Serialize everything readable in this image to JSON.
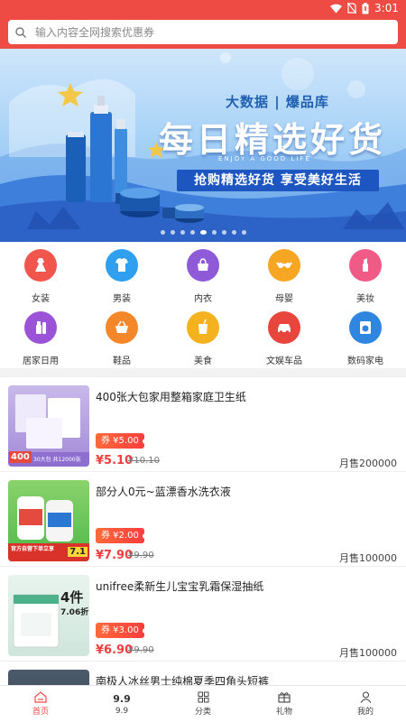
{
  "status": {
    "time": "3:01"
  },
  "search": {
    "placeholder": "输入内容全网搜索优惠券"
  },
  "banner": {
    "subtitle": "大数据 | 爆品库",
    "title": "每日精选好货",
    "english": "ENJOY A GOOD LIFE",
    "slogan": "抢购精选好货  享受美好生活",
    "dot_count": 9,
    "active_dot": 4
  },
  "categories": [
    {
      "label": "女装",
      "icon": "dress-icon",
      "color": "#f0564b"
    },
    {
      "label": "男装",
      "icon": "shirt-icon",
      "color": "#2f9ff0"
    },
    {
      "label": "内衣",
      "icon": "bag-icon",
      "color": "#8e5ad8"
    },
    {
      "label": "母婴",
      "icon": "bra-icon",
      "color": "#f6a623"
    },
    {
      "label": "美妆",
      "icon": "lipstick-icon",
      "color": "#f05a86"
    },
    {
      "label": "居家日用",
      "icon": "cleaning-icon",
      "color": "#9a53d6"
    },
    {
      "label": "鞋品",
      "icon": "basket-icon",
      "color": "#f5872b"
    },
    {
      "label": "美食",
      "icon": "drink-icon",
      "color": "#f4b21e"
    },
    {
      "label": "文娱车品",
      "icon": "car-icon",
      "color": "#e8453c"
    },
    {
      "label": "数码家电",
      "icon": "washer-icon",
      "color": "#2e86e0"
    }
  ],
  "products": [
    {
      "title": "400张大包家用整箱家庭卫生纸",
      "coupon": "券 ¥5.00",
      "price": "¥5.10",
      "original": "¥10.10",
      "sales": "月售200000",
      "thumb_caption": "400",
      "thumb_sub": "30大包 共12000张"
    },
    {
      "title": "部分人0元~蓝漂香水洗衣液",
      "coupon": "券 ¥2.00",
      "price": "¥7.90",
      "original": "¥9.90",
      "sales": "月售100000",
      "thumb_caption": "7.1",
      "thumb_sub": "官方自营下单立享"
    },
    {
      "title": "unifree柔新生儿宝宝乳霜保湿抽纸",
      "coupon": "券 ¥3.00",
      "price": "¥6.90",
      "original": "¥9.90",
      "sales": "月售100000",
      "thumb_caption": "4件",
      "thumb_sub": "7.06折"
    },
    {
      "title": "南极人冰丝男士纯棉夏季四角头短裤",
      "coupon": "",
      "price": "",
      "original": "",
      "sales": ""
    }
  ],
  "tabs": [
    {
      "label": "首页",
      "icon": "home-icon"
    },
    {
      "label": "9.9",
      "icon": "nine-nine-icon"
    },
    {
      "label": "分类",
      "icon": "grid-icon"
    },
    {
      "label": "礼物",
      "icon": "gift-icon"
    },
    {
      "label": "我的",
      "icon": "user-icon"
    }
  ],
  "colors": {
    "brand": "#ef4b45",
    "price": "#ef3f3f"
  }
}
